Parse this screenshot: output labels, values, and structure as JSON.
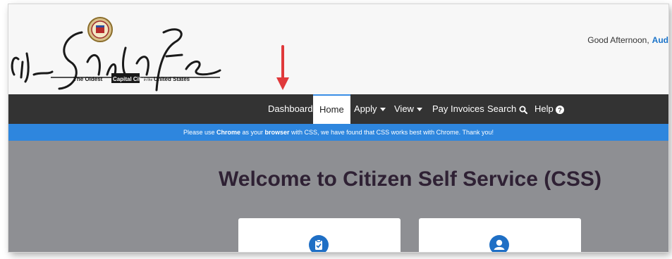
{
  "header": {
    "logo": {
      "script_text": "City of Santa Fe",
      "tagline_parts": [
        "The Oldest",
        "Capital City",
        "in the",
        "United States"
      ]
    },
    "greeting": "Good Afternoon,",
    "user_name": "Aud"
  },
  "nav": {
    "items": [
      {
        "label": "Dashboard"
      },
      {
        "label": "Home",
        "active": true
      },
      {
        "label": "Apply",
        "dropdown": true
      },
      {
        "label": "View",
        "dropdown": true
      },
      {
        "label": "Pay Invoices"
      },
      {
        "label": "Search",
        "icon": "search-icon"
      },
      {
        "label": "Help",
        "icon": "help-icon"
      }
    ]
  },
  "banner": {
    "text_1": "Please use ",
    "bold_1": "Chrome",
    "text_2": " as your ",
    "bold_2": "browser",
    "text_3": " with CSS, we have found that CSS works best with Chrome. Thank you!"
  },
  "main": {
    "welcome_title": "Welcome to Citizen Self Service (CSS)",
    "cards": [
      {
        "icon": "clipboard-check-icon"
      },
      {
        "icon": "user-icon"
      }
    ]
  },
  "colors": {
    "nav_bg": "#333333",
    "banner_bg": "#2e86de",
    "main_bg": "#8e8f93",
    "title": "#2f2134",
    "arrow": "#e0393b",
    "icon_blue": "#1f6fc5"
  }
}
